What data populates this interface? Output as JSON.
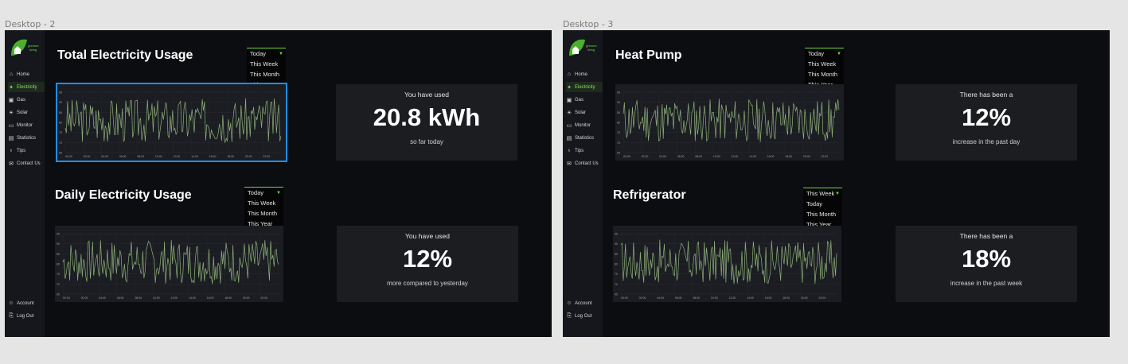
{
  "frames": [
    {
      "label": "Desktop - 2",
      "sidebar": {
        "logo_text": "greener living",
        "items": [
          {
            "label": "Home",
            "icon": "home-icon"
          },
          {
            "label": "Electricity",
            "icon": "bolt-icon",
            "active": true
          },
          {
            "label": "Gas",
            "icon": "gas-icon"
          },
          {
            "label": "Solar",
            "icon": "sun-icon"
          },
          {
            "label": "Monitor",
            "icon": "monitor-icon"
          },
          {
            "label": "Statistics",
            "icon": "statistics-icon"
          },
          {
            "label": "Tips",
            "icon": "lightbulb-icon"
          },
          {
            "label": "Contact Us",
            "icon": "mail-icon"
          }
        ],
        "bottom_items": [
          {
            "label": "Account",
            "icon": "account-icon"
          },
          {
            "label": "Log Out",
            "icon": "logout-icon"
          }
        ]
      },
      "sections": [
        {
          "title": "Total Electricity Usage",
          "dropdown": [
            "Today",
            "This Week",
            "This Month",
            "This Year"
          ],
          "chart_index": 0,
          "card": {
            "top": "You have used",
            "big": "20.8 kWh",
            "bottom": "so far today"
          }
        },
        {
          "title": "Daily Electricity Usage",
          "dropdown": [
            "Today",
            "This Week",
            "This Month",
            "This Year"
          ],
          "chart_index": 1,
          "card": {
            "top": "You have used",
            "big": "12%",
            "bottom": "more compared to yesterday"
          }
        }
      ]
    },
    {
      "label": "Desktop - 3",
      "sidebar": {
        "logo_text": "greener living",
        "items": [
          {
            "label": "Home",
            "icon": "home-icon"
          },
          {
            "label": "Electricity",
            "icon": "bolt-icon",
            "active": true
          },
          {
            "label": "Gas",
            "icon": "gas-icon"
          },
          {
            "label": "Solar",
            "icon": "sun-icon"
          },
          {
            "label": "Monitor",
            "icon": "monitor-icon"
          },
          {
            "label": "Statistics",
            "icon": "statistics-icon"
          },
          {
            "label": "Tips",
            "icon": "lightbulb-icon"
          },
          {
            "label": "Contact Us",
            "icon": "mail-icon"
          }
        ],
        "bottom_items": [
          {
            "label": "Account",
            "icon": "account-icon"
          },
          {
            "label": "Log Out",
            "icon": "logout-icon"
          }
        ]
      },
      "sections": [
        {
          "title": "Heat Pump",
          "dropdown": [
            "Today",
            "This Week",
            "This Month",
            "This Year"
          ],
          "chart_index": 2,
          "card": {
            "top": "There has been a",
            "big": "12%",
            "bottom": "increase in the past day"
          }
        },
        {
          "title": "Refrigerator",
          "dropdown": [
            "This Week",
            "Today",
            "This Month",
            "This Year"
          ],
          "chart_index": 3,
          "card": {
            "top": "There has been a",
            "big": "18%",
            "bottom": "increase in the past week"
          }
        }
      ]
    }
  ],
  "colors": {
    "accent": "#6ddc3c",
    "line": "#8fb07a",
    "selection": "#1f8ef1"
  },
  "chart_data": [
    {
      "type": "line",
      "xlabel": "",
      "ylabel": "",
      "x": [
        "00:00",
        "02:00",
        "04:00",
        "06:00",
        "08:00",
        "10:00",
        "12:00",
        "14:00",
        "16:00",
        "18:00",
        "20:00",
        "22:00"
      ],
      "y_ticks": [
        65,
        70,
        75,
        80,
        85,
        90,
        95
      ],
      "ylim": [
        65,
        95
      ],
      "seed": 3
    },
    {
      "type": "line",
      "xlabel": "",
      "ylabel": "",
      "x": [
        "00:00",
        "02:00",
        "04:00",
        "06:00",
        "08:00",
        "10:00",
        "12:00",
        "14:00",
        "16:00",
        "18:00",
        "20:00",
        "22:00"
      ],
      "y_ticks": [
        65,
        70,
        75,
        80,
        85,
        90,
        95
      ],
      "ylim": [
        65,
        95
      ],
      "seed": 7
    },
    {
      "type": "line",
      "xlabel": "",
      "ylabel": "",
      "x": [
        "00:00",
        "02:00",
        "04:00",
        "06:00",
        "08:00",
        "10:00",
        "12:00",
        "14:00",
        "16:00",
        "18:00",
        "20:00",
        "22:00"
      ],
      "y_ticks": [
        65,
        70,
        75,
        80,
        85,
        90,
        95
      ],
      "ylim": [
        65,
        95
      ],
      "seed": 11
    },
    {
      "type": "line",
      "xlabel": "",
      "ylabel": "",
      "x": [
        "00:00",
        "02:00",
        "04:00",
        "06:00",
        "08:00",
        "10:00",
        "12:00",
        "14:00",
        "16:00",
        "18:00",
        "20:00",
        "22:00"
      ],
      "y_ticks": [
        65,
        70,
        75,
        80,
        85,
        90,
        95
      ],
      "ylim": [
        65,
        95
      ],
      "seed": 17
    }
  ]
}
